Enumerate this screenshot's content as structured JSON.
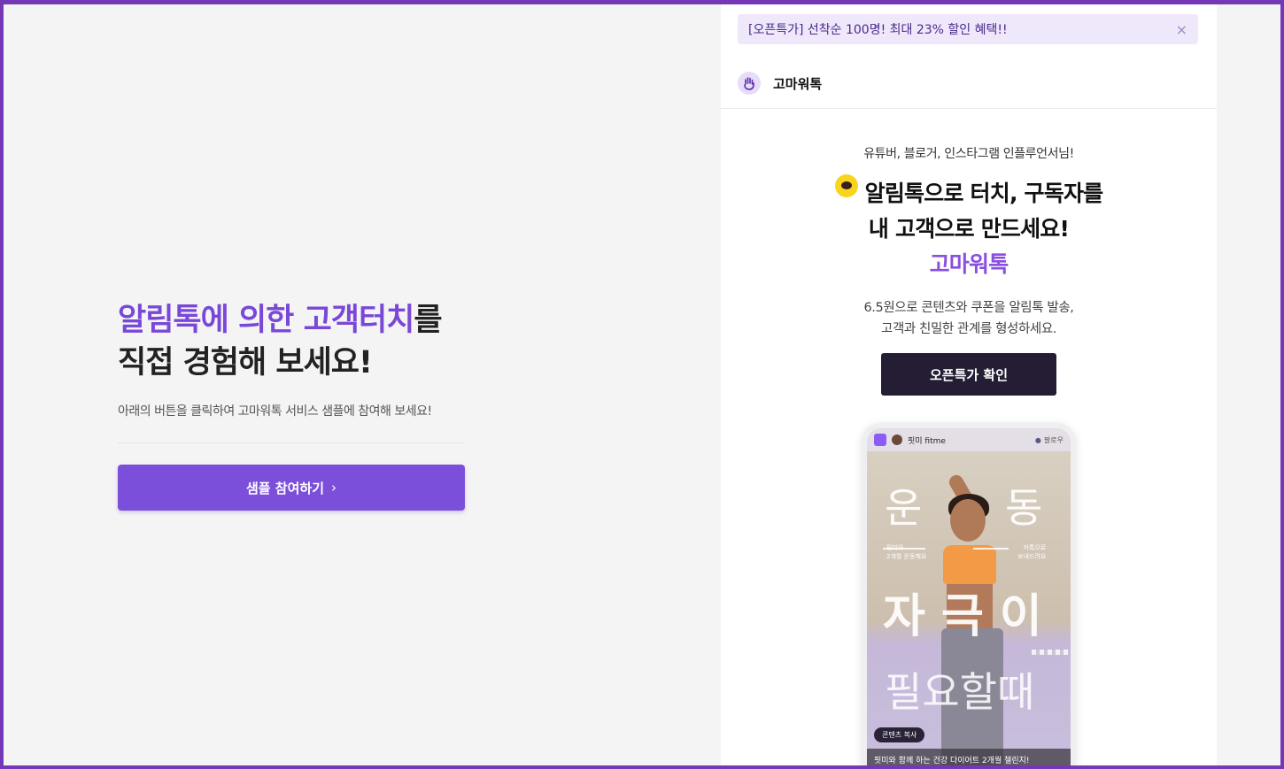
{
  "left": {
    "headline_accent": "알림톡에 의한 고객터치",
    "headline_rest": "를",
    "headline_line2": "직접 경험해 보세요!",
    "subtext": "아래의 버튼을 클릭하여 고마워톡 서비스 샘플에 참여해 보세요!",
    "cta_label": "샘플 참여하기",
    "cta_chevron": "›"
  },
  "panel": {
    "promo_text": "[오픈특가] 선착순 100명! 최대 23% 할인 혜택!!",
    "promo_close": "×",
    "brand_name": "고마워톡",
    "intro": "유튜버, 블로거, 인스타그램 인플루언서님!",
    "title_line1": "알림톡으로 터치, 구독자를",
    "title_line2": "내 고객으로 만드세요!",
    "title_brand": "고마워톡",
    "desc_line1": "6.5원으로 콘텐츠와 쿠폰을 알림톡 발송,",
    "desc_line2": "고객과 친밀한 관계를 형성하세요.",
    "button_label": "오픈특가 확인"
  },
  "phone": {
    "account": "핏미 fitme",
    "follow": "팔로우",
    "word1": "운",
    "word2": "동",
    "note_left_1": "핏미와",
    "note_left_2": "2개월 운동해요",
    "note_right_1": "카톡으로",
    "note_right_2": "보내드려요",
    "word3": "자 극 이",
    "word4": "필요할때",
    "tag": "콘텐츠 복사",
    "caption": "핏미와 함께 하는 건강 다이어트 2개월 챌린지!"
  },
  "colors": {
    "accent": "#7c4fdb",
    "frame": "#7437b6",
    "dark_button": "#251d33",
    "kakao_yellow": "#f7d51d"
  }
}
